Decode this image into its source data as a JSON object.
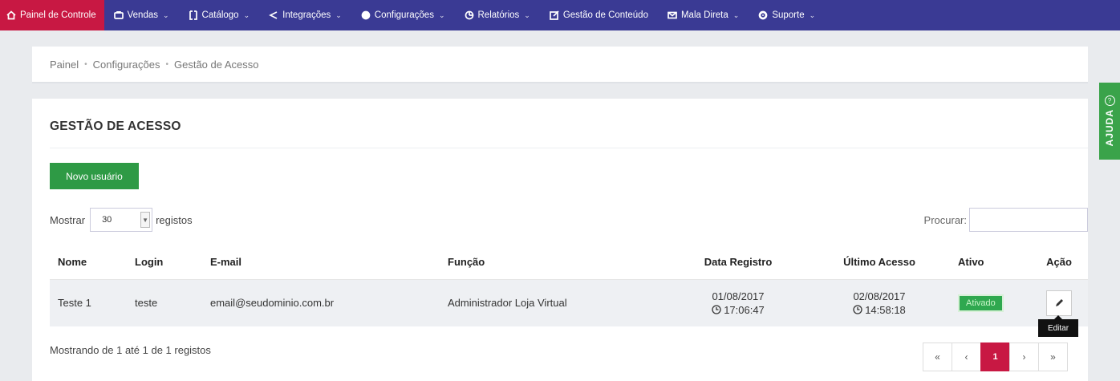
{
  "nav": {
    "items": [
      {
        "label": "Painel de Controle",
        "icon": "home-icon",
        "chevron": false
      },
      {
        "label": "Vendas",
        "icon": "cart-icon",
        "chevron": true
      },
      {
        "label": "Catálogo",
        "icon": "book-icon",
        "chevron": true
      },
      {
        "label": "Integrações",
        "icon": "share-icon",
        "chevron": true
      },
      {
        "label": "Configurações",
        "icon": "gear-icon",
        "chevron": true
      },
      {
        "label": "Relatórios",
        "icon": "chart-icon",
        "chevron": true
      },
      {
        "label": "Gestão de Conteúdo",
        "icon": "edit-icon",
        "chevron": false
      },
      {
        "label": "Mala Direta",
        "icon": "mail-icon",
        "chevron": true
      },
      {
        "label": "Suporte",
        "icon": "support-icon",
        "chevron": true
      }
    ]
  },
  "breadcrumb": [
    "Painel",
    "Configurações",
    "Gestão de Acesso"
  ],
  "panel": {
    "title": "GESTÃO DE ACESSO",
    "new_user_label": "Novo usuário",
    "show_label": "Mostrar",
    "show_value": "30",
    "records_label": "registos",
    "search_label": "Procurar:"
  },
  "table": {
    "headers": [
      "Nome",
      "Login",
      "E-mail",
      "Função",
      "Data Registro",
      "Último Acesso",
      "Ativo",
      "Ação"
    ],
    "rows": [
      {
        "name": "Teste 1",
        "login": "teste",
        "email": "email@seudominio.com.br",
        "role": "Administrador Loja Virtual",
        "reg_date": "01/08/2017",
        "reg_time": "17:06:47",
        "last_date": "02/08/2017",
        "last_time": "14:58:18",
        "active": "Ativado"
      }
    ]
  },
  "tooltip": "Editar",
  "footer_info": "Mostrando de 1 até 1 de 1 registos",
  "pagination": [
    "«",
    "‹",
    "1",
    "›",
    "»"
  ],
  "help_tab": "AJUDA",
  "colors": {
    "nav_bg": "#3a3a94",
    "accent": "#c81843",
    "success": "#2e9a45"
  }
}
